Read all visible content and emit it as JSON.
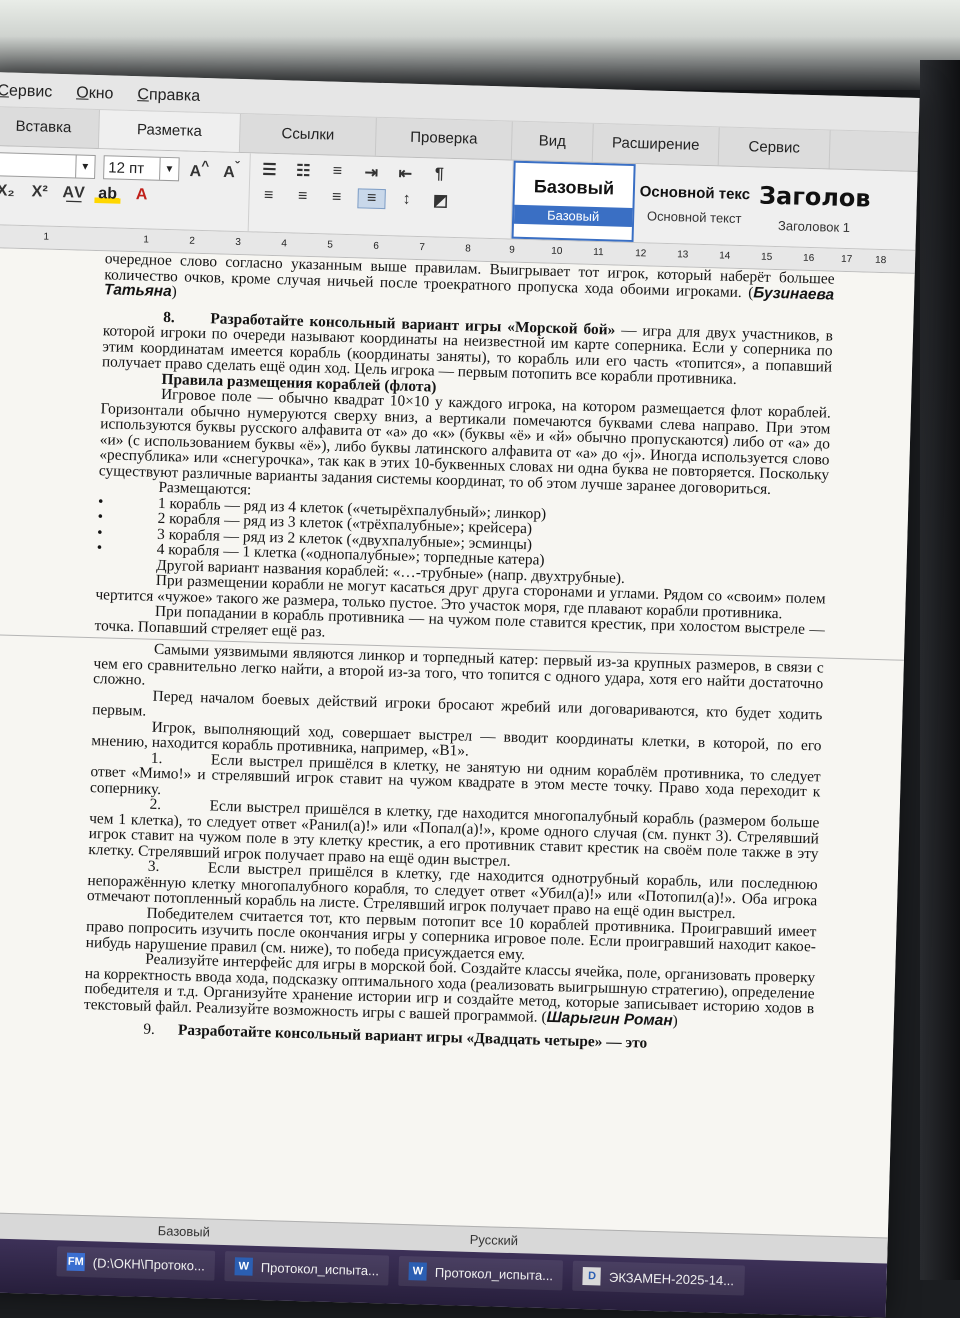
{
  "menu": [
    "Сервис",
    "Окно",
    "Справка"
  ],
  "tabs": [
    "Вставка",
    "Разметка",
    "Ссылки",
    "Проверка",
    "Вид",
    "Расширение",
    "Сервис"
  ],
  "toolbar": {
    "font_size": "12 пт",
    "subscript": "X₂",
    "superscript": "X²",
    "grow_font": "A",
    "shrink_font": "A"
  },
  "styles": [
    {
      "preview": "Базовый",
      "label": "Базовый"
    },
    {
      "preview": "Основной текс",
      "label": "Основной текст"
    },
    {
      "preview": "Заголов",
      "label": "Заголовок 1"
    }
  ],
  "ruler": [
    "2",
    "1",
    "1",
    "2",
    "3",
    "4",
    "5",
    "6",
    "7",
    "8",
    "9",
    "10",
    "11",
    "12",
    "13",
    "14",
    "15",
    "16",
    "17",
    "18"
  ],
  "document": {
    "intro": "очередное слово согласно указанным выше правилам. Выигрывает тот игрок, который наберёт большее количество очков, кроме случая ничьей после троекратного пропуска хода обоими игроками. (",
    "intro_author": "Бузинаева Татьяна",
    "intro_end": ")",
    "task_num": "8.",
    "task_title": "Разработайте консольный вариант игры «Морской бой»",
    "task_text": " — игра для двух участников, в которой игроки по очереди называют координаты на неизвестной им карте соперника. Если у соперника по этим координатам имеется корабль (координаты заняты), то корабль или его часть «топится», а попавший получает право сделать ещё один ход. Цель игрока — первым потопить все корабли противника.",
    "rules_heading": "Правила размещения кораблей (флота)",
    "p_field": "Игровое поле — обычно квадрат 10×10 у каждого игрока, на котором размещается флот кораблей. Горизонтали обычно нумеруются сверху вниз, а вертикали помечаются буквами слева направо. При этом используются буквы русского алфавита от «а» до «к» (буквы «ё» и «й» обычно пропускаются) либо от «а» до «и» (с использованием буквы «ё»), либо буквы латинского алфавита от «a» до «j». Иногда используется слово «республика» или «снегурочка», так как в этих 10-буквенных словах ни одна буква не повторяется. Поскольку существуют различные варианты задания системы координат, то об этом лучше заранее договориться.",
    "placed": "Размещаются:",
    "ships": [
      "1 корабль — ряд из 4 клеток («четырёхпалубный»; линкор)",
      "2 корабля — ряд из 3 клеток («трёхпалубные»; крейсера)",
      "3 корабля — ряд из 2 клеток («двухпалубные»; эсминцы)",
      "4 корабля — 1 клетка («однопалубные»; торпедные катера)"
    ],
    "p_other": "Другой вариант названия кораблей: «…-трубные» (напр. двухтрубные).",
    "p_place": "При размещении корабли не могут касаться друг друга сторонами и углами. Рядом со «своим» полем чертится «чужое» такого же размера, только пустое. Это участок моря, где плавают корабли противника.",
    "p_hit": "При попадании в корабль противника — на чужом поле ставится крестик, при холостом выстреле — точка. Попавший стреляет ещё раз.",
    "p_vuln": "Самыми уязвимыми являются линкор и торпедный катер: первый из-за крупных размеров, в связи с чем его сравнительно легко найти, а второй из-за того, что топится с одного удара, хотя его найти достаточно сложно.",
    "p_start": "Перед началом боевых действий игроки бросают жребий или договариваются, кто будет ходить первым.",
    "p_move": "Игрок, выполняющий ход, совершает выстрел — вводит координаты клетки, в которой, по его мнению, находится корабль противника, например, «В1».",
    "items": [
      {
        "n": "1.",
        "text": "Если выстрел пришёлся в клетку, не занятую ни одним кораблём противника, то следует ответ «Мимо!» и стрелявший игрок ставит на чужом квадрате в этом месте точку. Право хода переходит к сопернику."
      },
      {
        "n": "2.",
        "text": "Если выстрел пришёлся в клетку, где находится многопалубный корабль (размером больше чем 1 клетка), то следует ответ «Ранил(а)!» или «Попал(а)!», кроме одного случая (см. пункт 3). Стрелявший игрок ставит на чужом поле в эту клетку крестик, а его противник ставит крестик на своём поле также в эту клетку. Стрелявший игрок получает право на ещё один выстрел."
      },
      {
        "n": "3.",
        "text": "Если выстрел пришёлся в клетку, где находится однотрубный корабль, или последнюю непоражённую клетку многопалубного корабля, то следует ответ «Убил(а)!» или «Потопил(а)!». Оба игрока отмечают потопленный корабль на листе. Стрелявший игрок получает право на ещё один выстрел."
      }
    ],
    "p_winner": "Победителем считается тот, кто первым потопит все 10 кораблей противника. Проигравший имеет право попросить изучить после окончания игры у соперника игровое поле. Если проигравший находит какое-нибудь нарушение правил (см. ниже), то победа присуждается ему.",
    "p_impl": "Реализуйте интерфейс для игры в морской бой. Создайте классы ячейка, поле, организовать проверку на корректность ввода хода, подсказку оптимального хода (реализовать выигрышную стратегию), определение победителя и т.д. Организуйте хранение истории игр и создайте метод, которые записывает историю ходов в текстовый файл. Реализуйте возможность игры с вашей программой. (",
    "impl_author": "Шарыгин Роман",
    "impl_end": ")",
    "next_num": "9.",
    "next_task": "Разработайте консольный вариант игры «Двадцать четыре» — это"
  },
  "statusbar": {
    "style": "Базовый",
    "language": "Русский"
  },
  "taskbar": [
    {
      "icon": "FM",
      "label": "(D:\\ОКН\\Протоко..."
    },
    {
      "icon": "W",
      "label": "Протокол_испыта..."
    },
    {
      "icon": "W",
      "label": "Протокол_испыта..."
    },
    {
      "icon": "D",
      "label": "ЭКЗАМЕН-2025-14..."
    }
  ]
}
